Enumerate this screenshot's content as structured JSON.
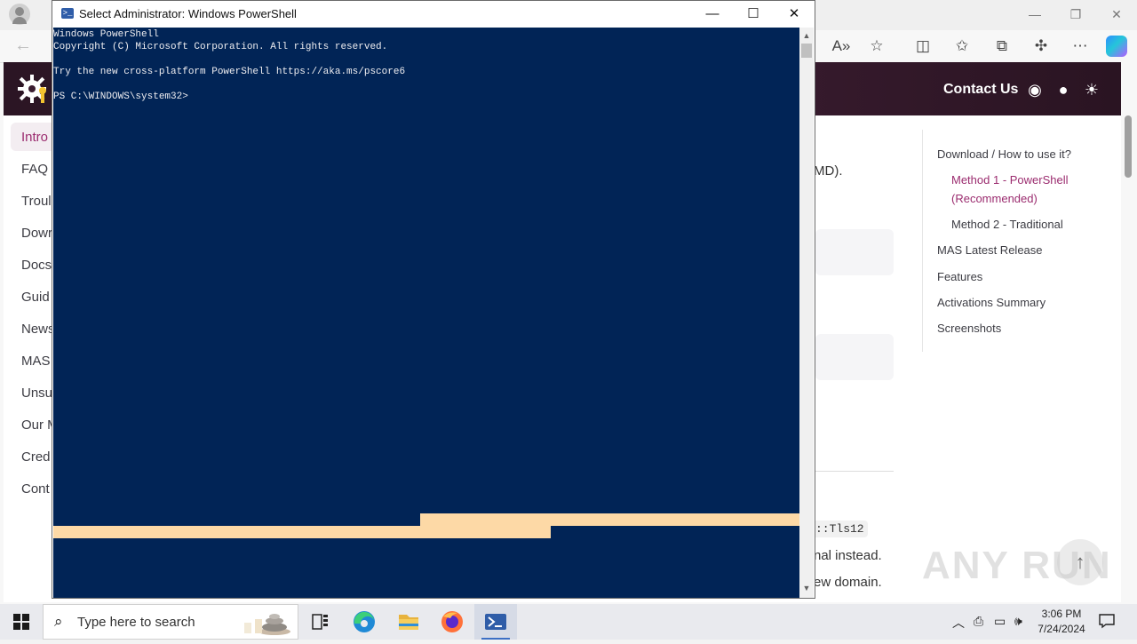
{
  "browser": {
    "back_label": "←",
    "toolbar_icons": [
      "read-aloud-icon",
      "favorite-star-icon",
      "split-screen-icon",
      "favorites-icon",
      "collections-icon",
      "extensions-icon",
      "more-icon"
    ],
    "window_controls": {
      "minimize": "—",
      "restore": "❐",
      "close": "✕"
    }
  },
  "page": {
    "header": {
      "contact_label": "Contact Us"
    },
    "nav_items": [
      "Intro",
      "FAQ",
      "Troul",
      "Dowr",
      "Docs",
      "Guid",
      "News",
      "MAS",
      "Unsu",
      "Our M",
      "Cred",
      "Cont"
    ],
    "main_fragments": {
      "text1": "MD).",
      "code1": "::Tls12",
      "text2": "nal instead.",
      "text3": "ew domain."
    },
    "outline": {
      "items": [
        "Download / How to use it?",
        "Method 1 - PowerShell (Recommended)",
        "Method 2 - Traditional",
        "MAS Latest Release",
        "Features",
        "Activations Summary",
        "Screenshots"
      ]
    },
    "scroll_top_label": "↑"
  },
  "watermark": "ANY RUN",
  "powershell": {
    "title": "Select Administrator: Windows PowerShell",
    "controls": {
      "minimize": "—",
      "maximize": "☐",
      "close": "✕"
    },
    "lines": [
      "Windows PowerShell",
      "Copyright (C) Microsoft Corporation. All rights reserved.",
      "",
      "Try the new cross-platform PowerShell https://aka.ms/pscore6",
      "",
      "PS C:\\WINDOWS\\system32>"
    ],
    "console_bg": "#012456",
    "highlight_color": "#fdd9a6"
  },
  "taskbar": {
    "search_placeholder": "Type here to search",
    "clock_time": "3:06 PM",
    "clock_date": "7/24/2024"
  }
}
